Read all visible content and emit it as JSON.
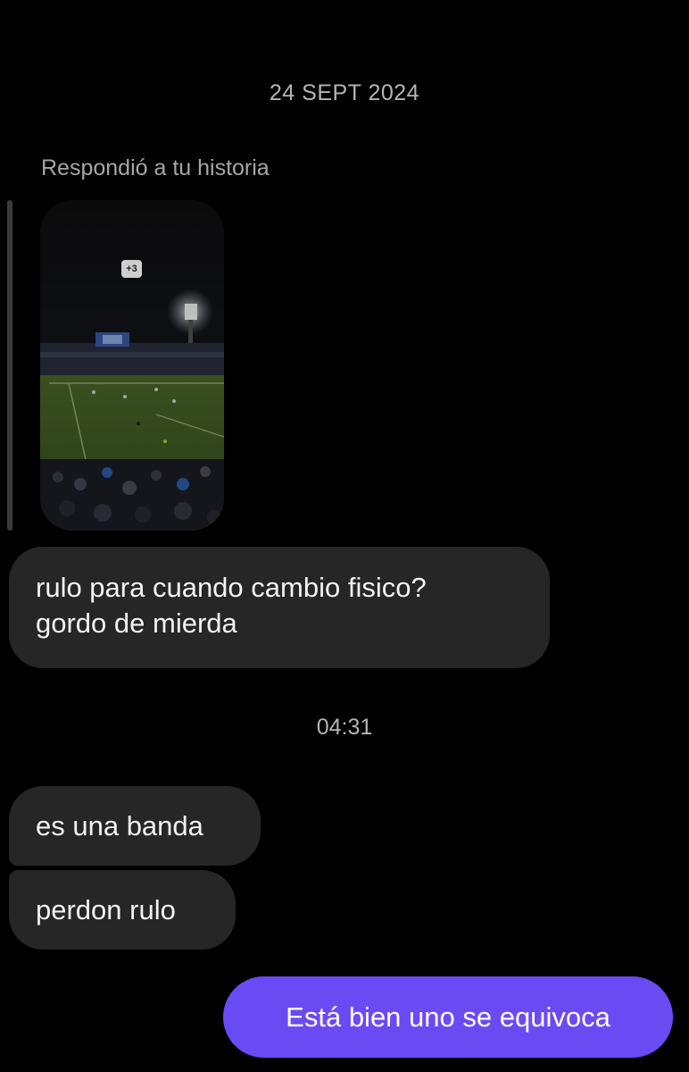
{
  "conversation": {
    "date_separator": "24 SEPT 2024",
    "reply_label": "Respondió a tu historia",
    "story": {
      "badge": "+3",
      "image_description_icon": "story-image"
    },
    "messages": [
      {
        "sender": "other",
        "lines": [
          "rulo para cuando cambio fisico?",
          "gordo de mierda"
        ]
      }
    ],
    "time_separator": "04:31",
    "later_messages": [
      {
        "sender": "other",
        "text": "es una banda"
      },
      {
        "sender": "other",
        "text": "perdon rulo"
      },
      {
        "sender": "me",
        "text": "Está bien uno se equivoca"
      }
    ],
    "colors": {
      "background": "#000000",
      "incoming_bubble": "#262626",
      "outgoing_bubble": "#6a4bf3",
      "muted_text": "#b4b4b4"
    }
  }
}
